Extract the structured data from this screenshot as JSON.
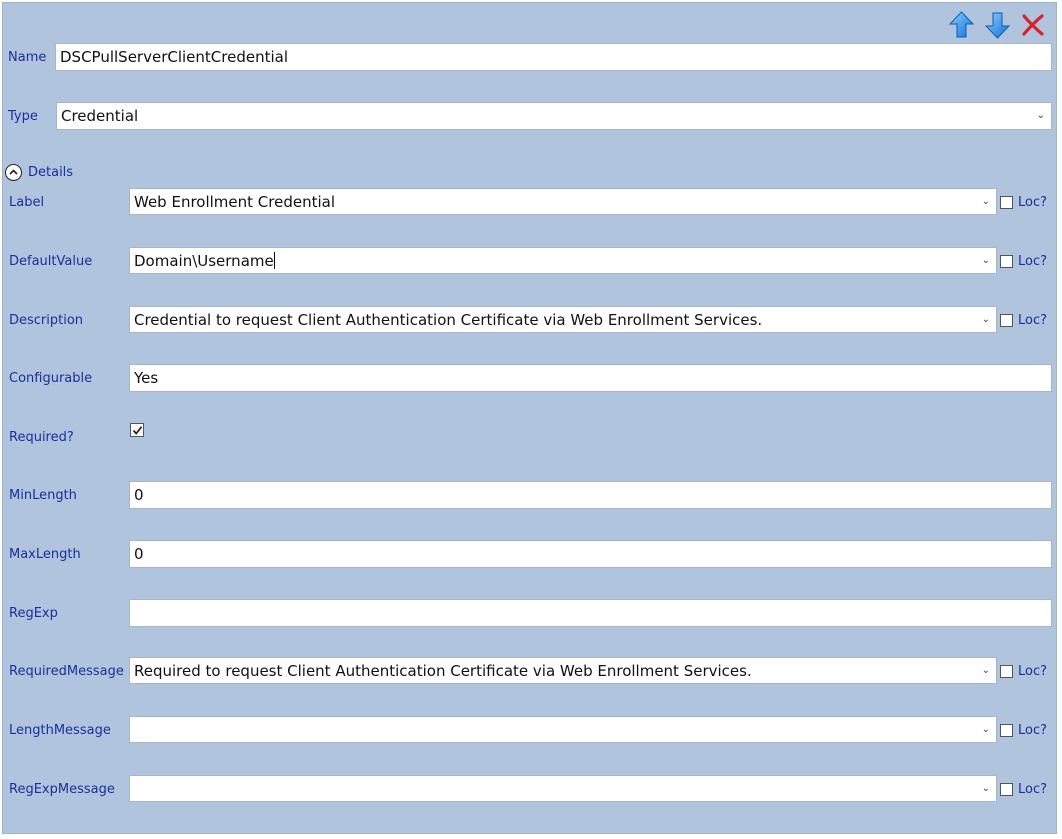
{
  "toolbar": {
    "move_up_icon": "arrow-up-icon",
    "move_down_icon": "arrow-down-icon",
    "delete_icon": "red-x-icon"
  },
  "header": {
    "name_label": "Name",
    "name_value": "DSCPullServerClientCredential",
    "type_label": "Type",
    "type_value": "Credential"
  },
  "details": {
    "toggle_label": "Details",
    "loc_label": "Loc?",
    "fields": {
      "label": {
        "label": "Label",
        "value": "Web Enrollment Credential"
      },
      "default_value": {
        "label": "DefaultValue",
        "value": "Domain\\Username"
      },
      "description": {
        "label": "Description",
        "value": "Credential to request Client Authentication Certificate via Web Enrollment Services."
      },
      "configurable": {
        "label": "Configurable",
        "value": "Yes"
      },
      "required": {
        "label": "Required?",
        "checked": true
      },
      "min_length": {
        "label": "MinLength",
        "value": "0"
      },
      "max_length": {
        "label": "MaxLength",
        "value": "0"
      },
      "regexp": {
        "label": "RegExp",
        "value": ""
      },
      "required_message": {
        "label": "RequiredMessage",
        "value": "Required to request Client Authentication Certificate via Web Enrollment Services."
      },
      "length_message": {
        "label": "LengthMessage",
        "value": ""
      },
      "regexp_message": {
        "label": "RegExpMessage",
        "value": ""
      }
    }
  },
  "colors": {
    "panel_background": "#b0c4de",
    "label_text": "#1a2f9c",
    "arrow_blue": "#1e90ff",
    "delete_red": "#d9232a"
  }
}
